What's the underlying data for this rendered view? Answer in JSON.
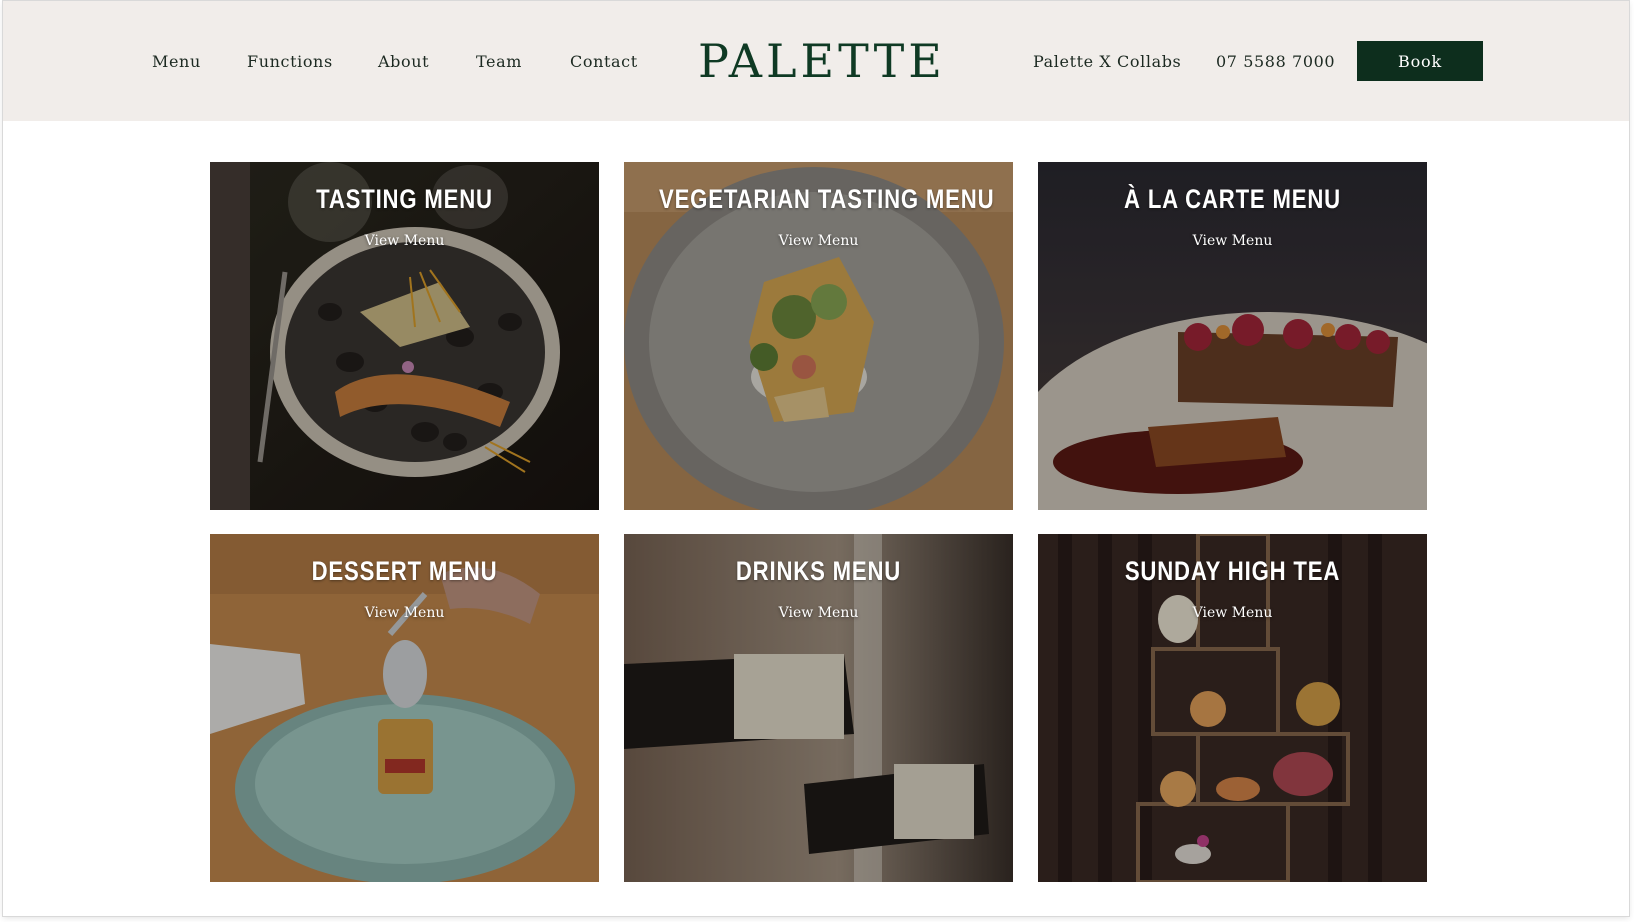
{
  "header": {
    "nav_left": [
      "Menu",
      "Functions",
      "About",
      "Team",
      "Contact"
    ],
    "logo": "PALETTE",
    "nav_right": [
      "Palette X Collabs",
      "07 5588 7000"
    ],
    "book_label": "Book"
  },
  "cards": [
    {
      "title": "TASTING MENU",
      "link": "View Menu"
    },
    {
      "title": "VEGETARIAN TASTING MENU",
      "link": "View Menu"
    },
    {
      "title": "À LA CARTE MENU",
      "link": "View Menu"
    },
    {
      "title": "DESSERT MENU",
      "link": "View Menu"
    },
    {
      "title": "DRINKS MENU",
      "link": "View Menu"
    },
    {
      "title": "SUNDAY HIGH TEA",
      "link": "View Menu"
    }
  ],
  "colors": {
    "header_bg": "#f1edea",
    "brand_green": "#0f3a24",
    "button_bg": "#0d2e1d"
  }
}
